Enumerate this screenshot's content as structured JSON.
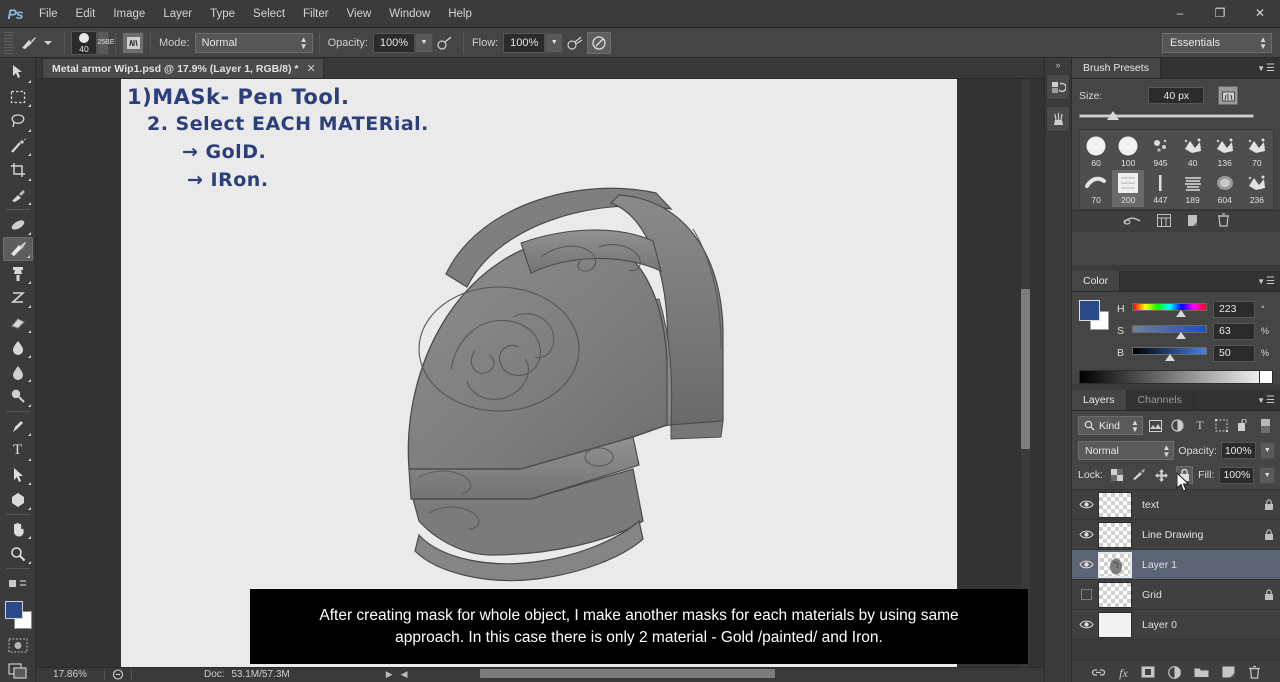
{
  "app": {
    "name": "Adobe Photoshop",
    "logo_text": "Ps"
  },
  "menubar": {
    "items": [
      "File",
      "Edit",
      "Image",
      "Layer",
      "Type",
      "Select",
      "Filter",
      "View",
      "Window",
      "Help"
    ],
    "window_controls": {
      "minimize": "–",
      "restore": "❐",
      "close": "✕"
    }
  },
  "options_bar": {
    "brush_size_number": "40",
    "mode_label": "Mode:",
    "mode_value": "Normal",
    "opacity_label": "Opacity:",
    "opacity_value": "100%",
    "flow_label": "Flow:",
    "flow_value": "100%",
    "workspace_value": "Essentials"
  },
  "toolbar": {
    "tools": [
      {
        "name": "move-tool",
        "glyph": "↖"
      },
      {
        "name": "rectangular-marquee-tool",
        "glyph": "⬚"
      },
      {
        "name": "lasso-tool",
        "glyph": "⥁"
      },
      {
        "name": "magic-wand-tool",
        "glyph": "✦"
      },
      {
        "name": "crop-tool",
        "glyph": "⌗"
      },
      {
        "name": "eyedropper-tool",
        "glyph": "✐"
      },
      {
        "name": "spot-healing-brush-tool",
        "glyph": "✒"
      },
      {
        "name": "brush-tool",
        "glyph": "✎"
      },
      {
        "name": "clone-stamp-tool",
        "glyph": "⚑"
      },
      {
        "name": "history-brush-tool",
        "glyph": "⌇"
      },
      {
        "name": "eraser-tool",
        "glyph": "▭"
      },
      {
        "name": "gradient-tool",
        "glyph": "◧"
      },
      {
        "name": "blur-tool",
        "glyph": "◍"
      },
      {
        "name": "dodge-tool",
        "glyph": "◔"
      },
      {
        "name": "zoom-sub-tool",
        "glyph": "○"
      },
      {
        "name": "pen-tool",
        "glyph": "✑"
      },
      {
        "name": "type-tool",
        "glyph": "T"
      },
      {
        "name": "path-selection-tool",
        "glyph": "➤"
      },
      {
        "name": "shape-tool",
        "glyph": "⬣"
      },
      {
        "name": "hand-tool",
        "glyph": "✋"
      },
      {
        "name": "zoom-tool",
        "glyph": "⚲"
      }
    ],
    "active_tool": "brush-tool",
    "foreground_color": "#2a4a8a",
    "background_color": "#ffffff"
  },
  "document": {
    "tab_title": "Metal armor Wip1.psd @ 17.9% (Layer 1, RGB/8) *",
    "close_glyph": "✕",
    "annotation_lines": [
      "1)MASk- Pen Tool.",
      "2. Select EACH MATERial.",
      "→ GolD.",
      "→ IRon."
    ]
  },
  "status_bar": {
    "zoom": "17.86%",
    "doc_label": "Doc:",
    "doc_value": "53.1M/57.3M"
  },
  "subtitle": {
    "text": "After creating mask for whole object, I make another masks for each materials by using same approach. In this case there is only 2 material - Gold /painted/ and Iron."
  },
  "icon_dock": {
    "collapse_glyph": "»",
    "buttons": [
      {
        "name": "history-panel-icon",
        "glyph": "↺"
      },
      {
        "name": "brush-panel-icon",
        "glyph": "❀"
      }
    ]
  },
  "brush_presets_panel": {
    "tab_label": "Brush Presets",
    "size_label": "Size:",
    "size_value": "40 px",
    "presets": [
      {
        "num": "60",
        "shape": "circle-large"
      },
      {
        "num": "100",
        "shape": "circle-large"
      },
      {
        "num": "945",
        "shape": "scatter"
      },
      {
        "num": "40",
        "shape": "splatter"
      },
      {
        "num": "136",
        "shape": "splatter"
      },
      {
        "num": "70",
        "shape": "splatter"
      },
      {
        "num": "70",
        "shape": "stroke"
      },
      {
        "num": "200",
        "shape": "square-texture"
      },
      {
        "num": "447",
        "shape": "thin-line"
      },
      {
        "num": "189",
        "shape": "ribbon"
      },
      {
        "num": "604",
        "shape": "soft-blob"
      },
      {
        "num": "236",
        "shape": "splatter"
      }
    ],
    "selected_preset_index": 7,
    "footer_icons": [
      "toggle-brush-icon",
      "new-preset-icon",
      "duplicate-icon",
      "delete-icon"
    ]
  },
  "color_panel": {
    "tab_label": "Color",
    "channels": [
      {
        "letter": "H",
        "value": "223",
        "unit": "°",
        "knob_pct": 62
      },
      {
        "letter": "S",
        "value": "63",
        "unit": "%",
        "knob_pct": 63
      },
      {
        "letter": "B",
        "value": "50",
        "unit": "%",
        "knob_pct": 50
      }
    ],
    "foreground_color": "#2a4a8a",
    "background_color": "#ffffff"
  },
  "layers_panel": {
    "tabs": [
      {
        "label": "Layers",
        "active": true
      },
      {
        "label": "Channels",
        "active": false
      }
    ],
    "filter_kind": "Kind",
    "filter_icons": [
      "pixel-filter-icon",
      "adjustment-filter-icon",
      "type-filter-icon",
      "shape-filter-icon",
      "smartobject-filter-icon"
    ],
    "blend_mode": "Normal",
    "opacity_label": "Opacity:",
    "opacity_value": "100%",
    "lock_label": "Lock:",
    "lock_icons": [
      "lock-transparent-icon",
      "lock-image-icon",
      "lock-position-icon",
      "lock-all-icon"
    ],
    "lock_active_index": 3,
    "fill_label": "Fill:",
    "fill_value": "100%",
    "layers": [
      {
        "name": "text",
        "visible": true,
        "locked": true,
        "selected": false,
        "thumb": "checker"
      },
      {
        "name": "Line Drawing",
        "visible": true,
        "locked": true,
        "selected": false,
        "thumb": "checker"
      },
      {
        "name": "Layer 1",
        "visible": true,
        "locked": false,
        "selected": true,
        "thumb": "checker-art"
      },
      {
        "name": "Grid",
        "visible": false,
        "locked": true,
        "selected": false,
        "thumb": "checker"
      },
      {
        "name": "Layer 0",
        "visible": true,
        "locked": false,
        "selected": false,
        "thumb": "white"
      }
    ],
    "footer_icons": [
      "link-layers-icon",
      "layer-style-icon",
      "layer-mask-icon",
      "adjustment-layer-icon",
      "new-group-icon",
      "new-layer-icon",
      "delete-layer-icon"
    ],
    "footer_glyphs": [
      "⚭",
      "fx",
      "▣",
      "◑",
      "▰",
      "◰",
      "Ὕ1"
    ]
  },
  "colors": {
    "panel_bg": "#454545",
    "chrome_bg": "#3b3b3b",
    "canvas_bg": "#333333",
    "paper": "#eaeaea",
    "selection_blue": "#5a6475",
    "accent_blue": "#2a4a8a"
  }
}
